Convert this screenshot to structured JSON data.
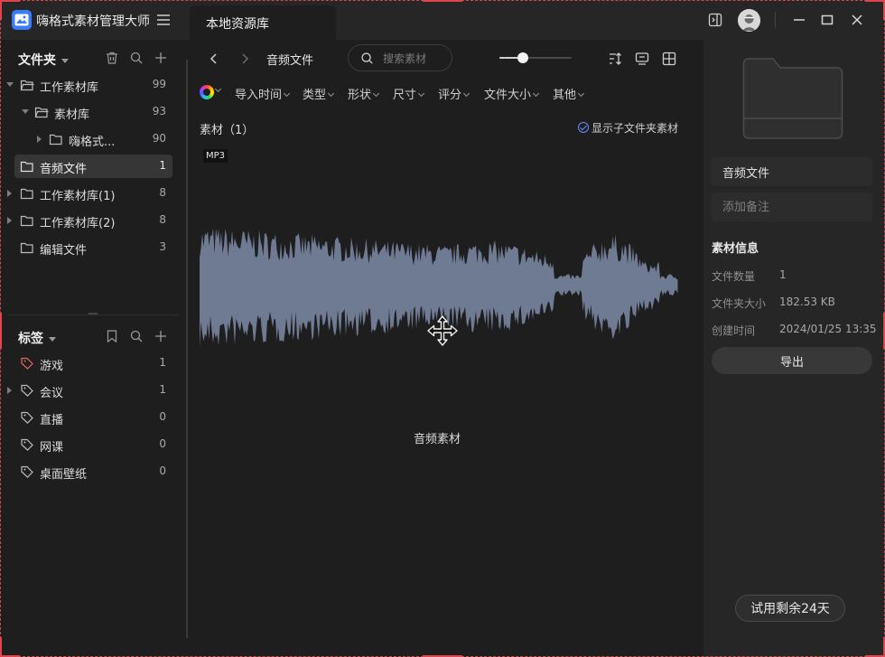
{
  "app": {
    "title": "嗨格式素材管理大师",
    "tab": "本地资源库"
  },
  "folders": {
    "header": "文件夹",
    "items": [
      {
        "label": "工作素材库",
        "count": "99"
      },
      {
        "label": "素材库",
        "count": "93"
      },
      {
        "label": "嗨格式...",
        "count": "90"
      },
      {
        "label": "音频文件",
        "count": "1"
      },
      {
        "label": "工作素材库(1)",
        "count": "8"
      },
      {
        "label": "工作素材库(2)",
        "count": "8"
      },
      {
        "label": "编辑文件",
        "count": "3"
      }
    ]
  },
  "tags": {
    "header": "标签",
    "items": [
      {
        "label": "游戏",
        "count": "1"
      },
      {
        "label": "会议",
        "count": "1"
      },
      {
        "label": "直播",
        "count": "0"
      },
      {
        "label": "网课",
        "count": "0"
      },
      {
        "label": "桌面壁纸",
        "count": "0"
      }
    ]
  },
  "toolbar": {
    "breadcrumb": "音频文件",
    "search_placeholder": "搜索素材",
    "zoom_level": 0.32
  },
  "filters": [
    "导入时间",
    "类型",
    "形状",
    "尺寸",
    "评分",
    "文件大小",
    "其他"
  ],
  "content": {
    "count_title": "素材（1）",
    "show_subfolder": "显示子文件夹素材",
    "item": {
      "format": "MP3",
      "name": "音频素材"
    }
  },
  "details": {
    "name_value": "音频文件",
    "note_placeholder": "添加备注",
    "info_title": "素材信息",
    "info": [
      {
        "key": "文件数量",
        "value": "1"
      },
      {
        "key": "文件夹大小",
        "value": "182.53 KB"
      },
      {
        "key": "创建时间",
        "value": "2024/01/25 13:35"
      }
    ],
    "export_label": "导出",
    "trial_label": "试用剩余24天"
  },
  "colors": {
    "accent": "#3a7bfd",
    "waveform": "#6f7a93",
    "frame": "#d4454c",
    "tag_game": "#e06b5c"
  }
}
